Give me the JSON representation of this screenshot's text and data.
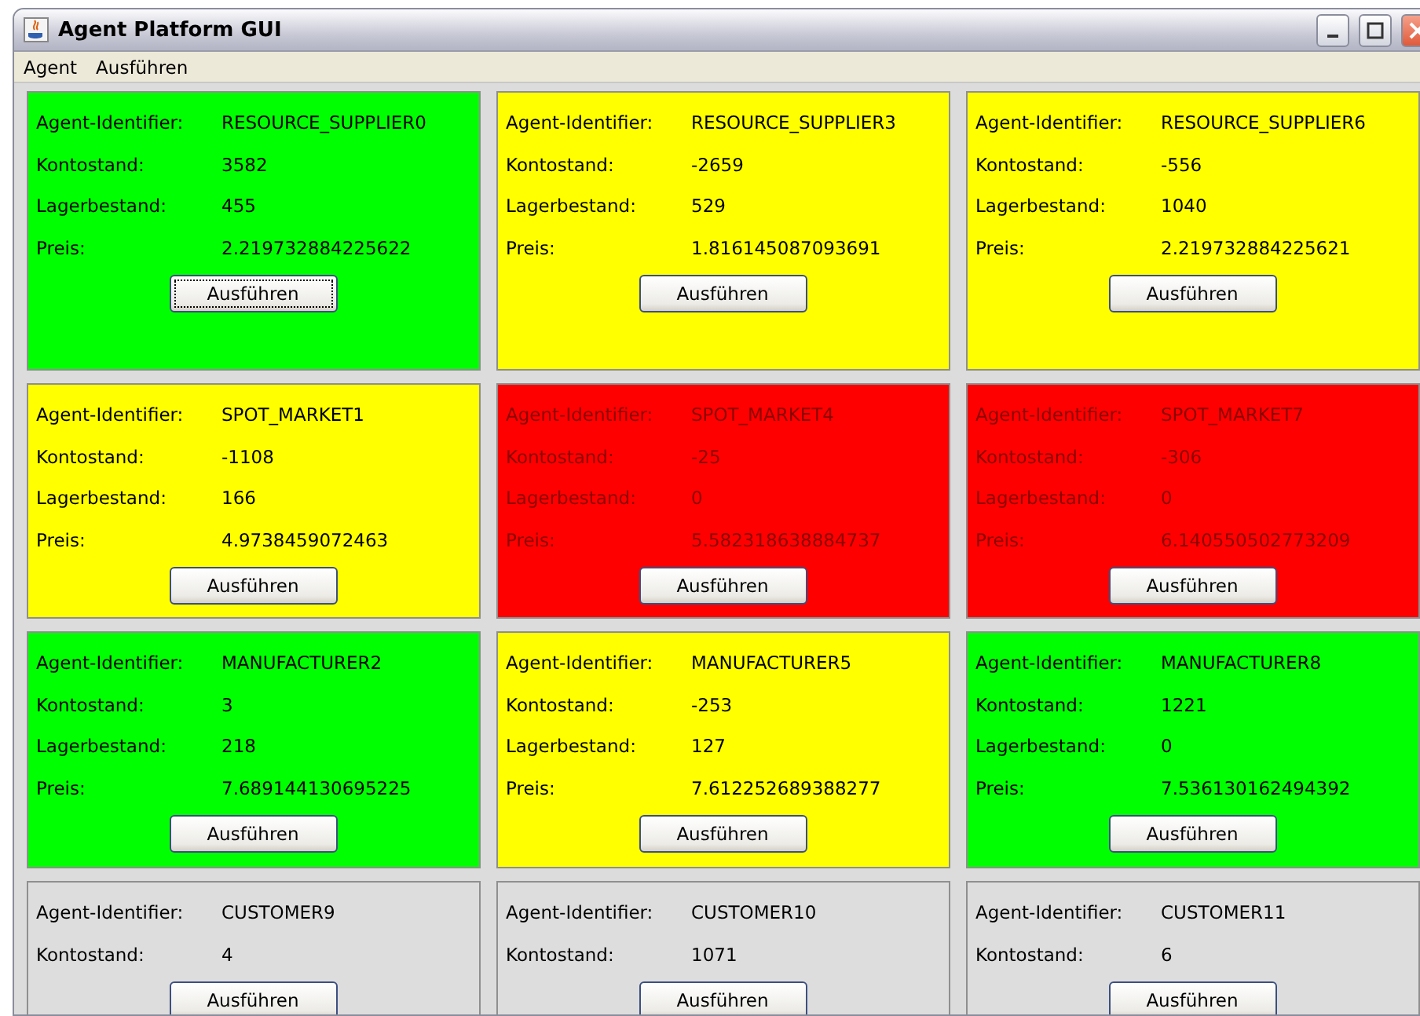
{
  "window": {
    "title": "Agent Platform GUI"
  },
  "menu": [
    {
      "label": "Agent"
    },
    {
      "label": "Ausführen"
    }
  ],
  "agents": [
    {
      "color": "#00ff00",
      "fields": [
        {
          "label": "Agent-Identifier:",
          "value": "RESOURCE_SUPPLIER0"
        },
        {
          "label": "Kontostand:",
          "value": "3582"
        },
        {
          "label": "Lagerbestand:",
          "value": "455"
        },
        {
          "label": "Preis:",
          "value": "2.219732884225622"
        }
      ],
      "button": {
        "label": "Ausführen",
        "focused": true
      }
    },
    {
      "color": "#ffff00",
      "fields": [
        {
          "label": "Agent-Identifier:",
          "value": "RESOURCE_SUPPLIER3"
        },
        {
          "label": "Kontostand:",
          "value": "-2659"
        },
        {
          "label": "Lagerbestand:",
          "value": "529"
        },
        {
          "label": "Preis:",
          "value": "1.816145087093691"
        }
      ],
      "button": {
        "label": "Ausführen",
        "focused": false
      }
    },
    {
      "color": "#ffff00",
      "fields": [
        {
          "label": "Agent-Identifier:",
          "value": "RESOURCE_SUPPLIER6"
        },
        {
          "label": "Kontostand:",
          "value": "-556"
        },
        {
          "label": "Lagerbestand:",
          "value": "1040"
        },
        {
          "label": "Preis:",
          "value": "2.219732884225621"
        }
      ],
      "button": {
        "label": "Ausführen",
        "focused": false
      }
    },
    {
      "color": "#ffff00",
      "fields": [
        {
          "label": "Agent-Identifier:",
          "value": "SPOT_MARKET1"
        },
        {
          "label": "Kontostand:",
          "value": "-1108"
        },
        {
          "label": "Lagerbestand:",
          "value": "166"
        },
        {
          "label": "Preis:",
          "value": "4.9738459072463"
        }
      ],
      "button": {
        "label": "Ausführen",
        "focused": false
      }
    },
    {
      "color": "#ff0000",
      "fields": [
        {
          "label": "Agent-Identifier:",
          "value": "SPOT_MARKET4"
        },
        {
          "label": "Kontostand:",
          "value": "-25"
        },
        {
          "label": "Lagerbestand:",
          "value": "0"
        },
        {
          "label": "Preis:",
          "value": "5.582318638884737"
        }
      ],
      "button": {
        "label": "Ausführen",
        "focused": false
      }
    },
    {
      "color": "#ff0000",
      "fields": [
        {
          "label": "Agent-Identifier:",
          "value": "SPOT_MARKET7"
        },
        {
          "label": "Kontostand:",
          "value": "-306"
        },
        {
          "label": "Lagerbestand:",
          "value": "0"
        },
        {
          "label": "Preis:",
          "value": "6.140550502773209"
        }
      ],
      "button": {
        "label": "Ausführen",
        "focused": false
      }
    },
    {
      "color": "#00ff00",
      "fields": [
        {
          "label": "Agent-Identifier:",
          "value": "MANUFACTURER2"
        },
        {
          "label": "Kontostand:",
          "value": "3"
        },
        {
          "label": "Lagerbestand:",
          "value": "218"
        },
        {
          "label": "Preis:",
          "value": "7.689144130695225"
        }
      ],
      "button": {
        "label": "Ausführen",
        "focused": false
      }
    },
    {
      "color": "#ffff00",
      "fields": [
        {
          "label": "Agent-Identifier:",
          "value": "MANUFACTURER5"
        },
        {
          "label": "Kontostand:",
          "value": "-253"
        },
        {
          "label": "Lagerbestand:",
          "value": "127"
        },
        {
          "label": "Preis:",
          "value": "7.612252689388277"
        }
      ],
      "button": {
        "label": "Ausführen",
        "focused": false
      }
    },
    {
      "color": "#00ff00",
      "fields": [
        {
          "label": "Agent-Identifier:",
          "value": "MANUFACTURER8"
        },
        {
          "label": "Kontostand:",
          "value": "1221"
        },
        {
          "label": "Lagerbestand:",
          "value": "0"
        },
        {
          "label": "Preis:",
          "value": "7.536130162494392"
        }
      ],
      "button": {
        "label": "Ausführen",
        "focused": false
      }
    },
    {
      "color": "#dddddd",
      "fields": [
        {
          "label": "Agent-Identifier:",
          "value": "CUSTOMER9"
        },
        {
          "label": "Kontostand:",
          "value": "4"
        }
      ],
      "button": {
        "label": "Ausführen",
        "focused": false
      }
    },
    {
      "color": "#dddddd",
      "fields": [
        {
          "label": "Agent-Identifier:",
          "value": "CUSTOMER10"
        },
        {
          "label": "Kontostand:",
          "value": "1071"
        }
      ],
      "button": {
        "label": "Ausführen",
        "focused": false
      }
    },
    {
      "color": "#dddddd",
      "fields": [
        {
          "label": "Agent-Identifier:",
          "value": "CUSTOMER11"
        },
        {
          "label": "Kontostand:",
          "value": "6"
        }
      ],
      "button": {
        "label": "Ausführen",
        "focused": false
      }
    }
  ]
}
